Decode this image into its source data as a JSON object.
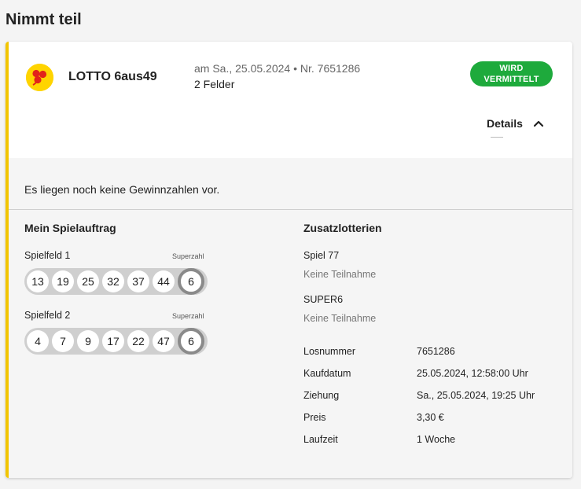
{
  "section": {
    "title": "Nimmt teil"
  },
  "ticket": {
    "logo_icon": "lotto-clover-icon",
    "game_name": "LOTTO 6aus49",
    "draw_info": "am Sa., 25.05.2024 • Nr. 7651286",
    "fields_count": "2 Felder",
    "status": {
      "line1": "WIRD",
      "line2": "VERMITTELT",
      "color": "#1eaa3c"
    },
    "details_label": "Details",
    "accent_color": "#f2c500"
  },
  "results": {
    "message": "Es liegen noch keine Gewinnzahlen vor."
  },
  "order": {
    "heading": "Mein Spielauftrag",
    "superzahl_label": "Superzahl",
    "fields": [
      {
        "label": "Spielfeld 1",
        "numbers": [
          "13",
          "19",
          "25",
          "32",
          "37",
          "44"
        ],
        "superzahl": "6"
      },
      {
        "label": "Spielfeld 2",
        "numbers": [
          "4",
          "7",
          "9",
          "17",
          "22",
          "47"
        ],
        "superzahl": "6"
      }
    ]
  },
  "extra": {
    "heading": "Zusatzlotterien",
    "lotteries": [
      {
        "name": "Spiel 77",
        "status": "Keine Teilnahme"
      },
      {
        "name": "SUPER6",
        "status": "Keine Teilnahme"
      }
    ],
    "info": [
      {
        "label": "Losnummer",
        "value": "7651286"
      },
      {
        "label": "Kaufdatum",
        "value": "25.05.2024, 12:58:00 Uhr"
      },
      {
        "label": "Ziehung",
        "value": "Sa., 25.05.2024, 19:25 Uhr"
      },
      {
        "label": "Preis",
        "value": "3,30 €"
      },
      {
        "label": "Laufzeit",
        "value": "1 Woche"
      }
    ]
  }
}
